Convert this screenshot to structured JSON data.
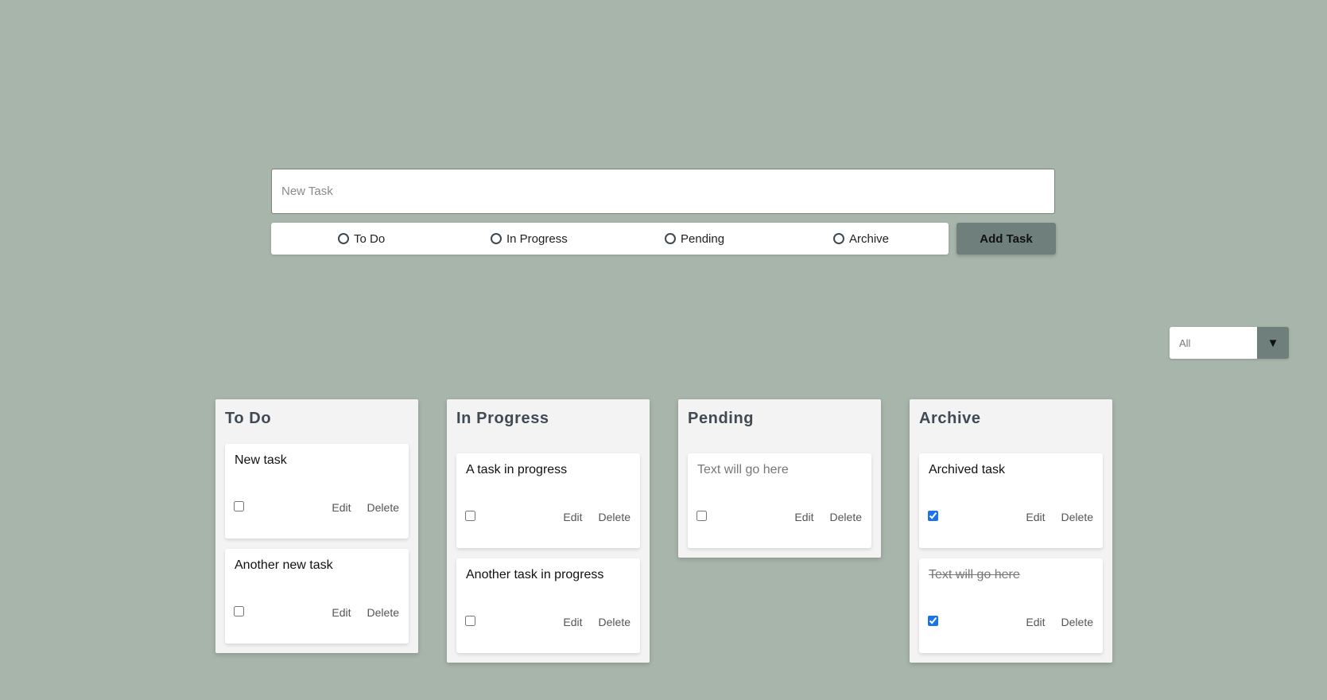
{
  "form": {
    "task_placeholder": "New Task",
    "task_value": "",
    "status_options": [
      "To Do",
      "In Progress",
      "Pending",
      "Archive"
    ],
    "add_button_label": "Add Task"
  },
  "filter": {
    "selected": "All",
    "arrow": "▼"
  },
  "card_actions": {
    "edit": "Edit",
    "delete": "Delete"
  },
  "columns": [
    {
      "title": "To Do",
      "cards": [
        {
          "text": "New task",
          "checked": false
        },
        {
          "text": "Another new task",
          "checked": false
        }
      ]
    },
    {
      "title": "In Progress",
      "cards": [
        {
          "text": "A task in progress",
          "checked": false
        },
        {
          "text": "Another task in progress",
          "checked": false
        }
      ]
    },
    {
      "title": "Pending",
      "cards": [
        {
          "text": "Text will go here",
          "checked": false,
          "placeholder": true
        }
      ]
    },
    {
      "title": "Archive",
      "cards": [
        {
          "text": "Archived task",
          "checked": true
        },
        {
          "text": "Text will go here",
          "checked": true,
          "strikethrough": true
        }
      ]
    }
  ],
  "colors": {
    "background": "#a8b5aa",
    "button": "#6f7f7b",
    "column_title": "#3f4a55",
    "checkbox_accent": "#1a73e8"
  }
}
